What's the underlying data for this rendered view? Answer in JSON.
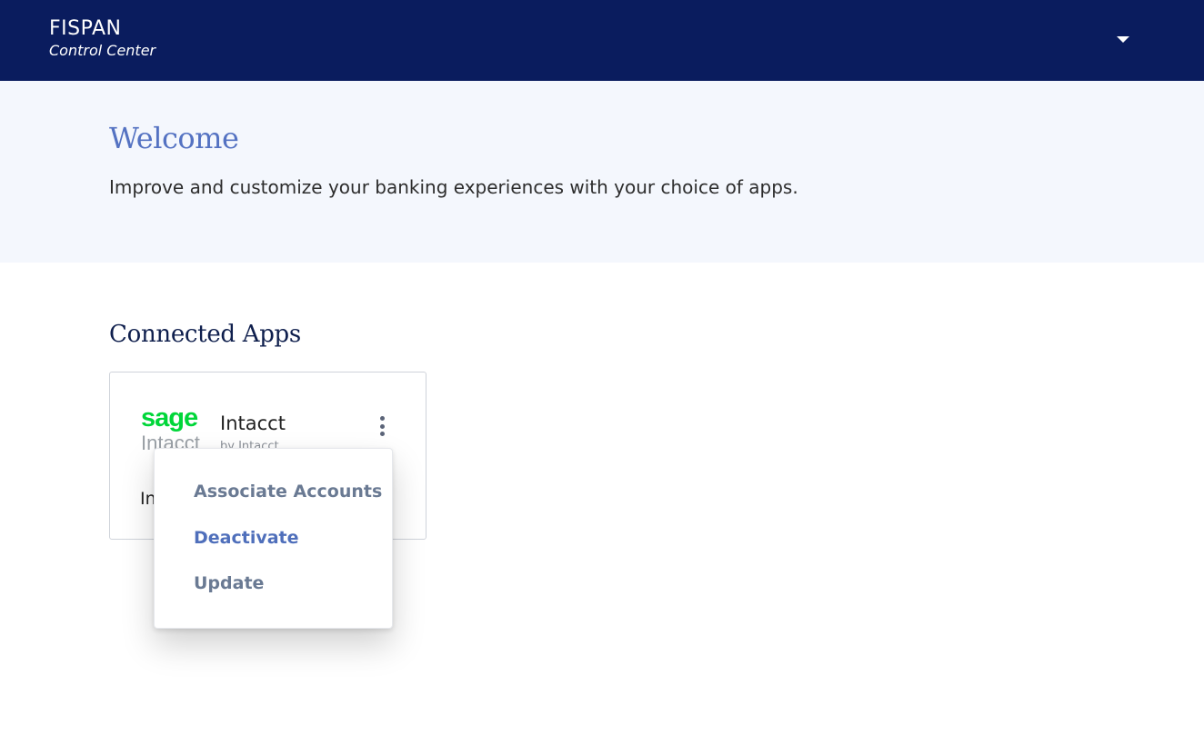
{
  "header": {
    "brand_name": "FISPAN",
    "brand_subtitle": "Control Center",
    "user_menu_icon": "chevron-down-icon"
  },
  "hero": {
    "title": "Welcome",
    "text": "Improve and customize your banking experiences with your choice of apps."
  },
  "connected_apps": {
    "title": "Connected Apps",
    "apps": [
      {
        "logo_word": "sage",
        "logo_sub": "Intacct",
        "name": "Intacct",
        "vendor": "by Intacct",
        "description": "In",
        "menu_icon": "kebab-menu-icon"
      }
    ]
  },
  "app_menu": {
    "items": [
      {
        "label": "Associate Accounts"
      },
      {
        "label": "Deactivate"
      },
      {
        "label": "Update"
      }
    ]
  },
  "colors": {
    "header_bg": "#0a1c5e",
    "hero_bg": "#f4f7fd",
    "accent": "#5472c2",
    "sage_green": "#00d639"
  }
}
